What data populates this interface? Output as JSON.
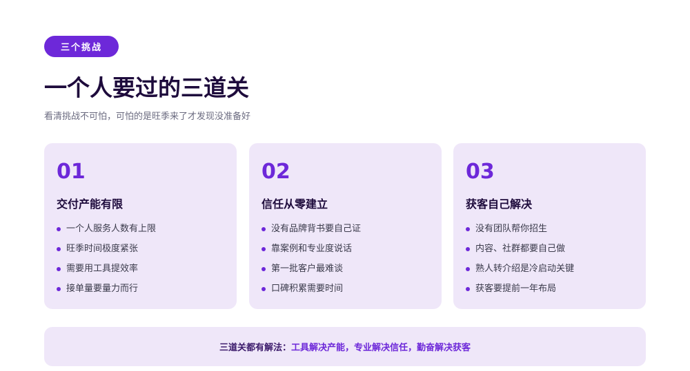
{
  "badge": "三个挑战",
  "title": "一个人要过的三道关",
  "subtitle": "看清挑战不可怕，可怕的是旺季来了才发现没准备好",
  "colors": {
    "accent": "#6d28d9",
    "card_bg": "#efe7f9",
    "heading": "#1e0b3c"
  },
  "cards": [
    {
      "num": "01",
      "title": "交付产能有限",
      "items": [
        "一个人服务人数有上限",
        "旺季时间极度紧张",
        "需要用工具提效率",
        "接单量要量力而行"
      ]
    },
    {
      "num": "02",
      "title": "信任从零建立",
      "items": [
        "没有品牌背书要自己证",
        "靠案例和专业度说话",
        "第一批客户最难谈",
        "口碑积累需要时间"
      ]
    },
    {
      "num": "03",
      "title": "获客自己解决",
      "items": [
        "没有团队帮你招生",
        "内容、社群都要自己做",
        "熟人转介绍是冷启动关键",
        "获客要提前一年布局"
      ]
    }
  ],
  "footer": {
    "lead": "三道关都有解法：",
    "highlight": "工具解决产能，专业解决信任，勤奋解决获客"
  }
}
